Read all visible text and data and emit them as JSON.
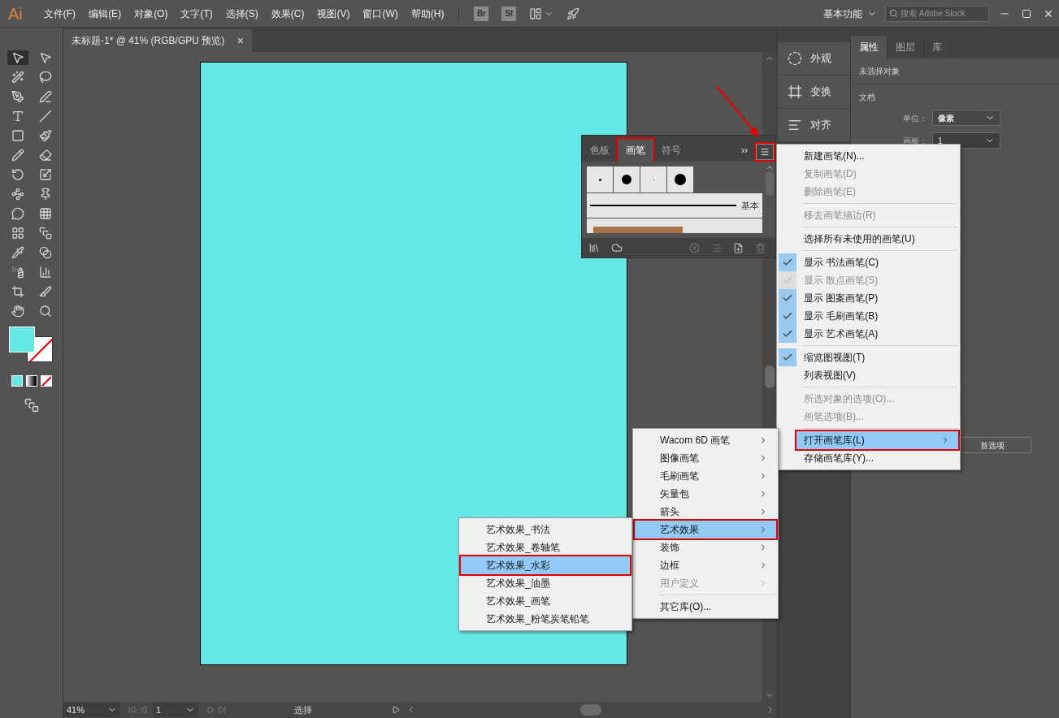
{
  "menubar": {
    "logo": "Ai",
    "menus": [
      "文件(F)",
      "编辑(E)",
      "对象(O)",
      "文字(T)",
      "选择(S)",
      "效果(C)",
      "视图(V)",
      "窗口(W)",
      "帮助(H)"
    ],
    "bridge": "Br",
    "stock": "St",
    "workspace": "基本功能",
    "search": {
      "placeholder": "搜索 Adobe Stock"
    }
  },
  "document_tab": {
    "title": "未标题-1* @ 41% (RGB/GPU 预览)",
    "close": "×"
  },
  "dock": [
    {
      "kind": "appearance",
      "label": "外观"
    },
    {
      "kind": "transform",
      "label": "变换"
    },
    {
      "kind": "align",
      "label": "对齐"
    }
  ],
  "properties": {
    "tabs": [
      {
        "label": "属性",
        "selected": true
      },
      {
        "label": "图层",
        "selected": false
      },
      {
        "label": "库",
        "selected": false
      }
    ],
    "status": "未选择对象",
    "section": "文档",
    "unit_label": "单位：",
    "unit_value": "像素",
    "artboard_label": "画板：",
    "artboard_value": "1",
    "preferences": "首选项"
  },
  "brushes_panel": {
    "tabs": [
      {
        "label": "色板",
        "selected": false,
        "annotated": false
      },
      {
        "label": "画笔",
        "selected": true,
        "annotated": true
      },
      {
        "label": "符号",
        "selected": false,
        "annotated": false
      }
    ],
    "more": "››",
    "basic_brush": "基本",
    "menu_annotated": true
  },
  "context_menu": [
    {
      "kind": "item",
      "label": "新建画笔(N)...",
      "checked": false,
      "disabled": false,
      "selected": false,
      "submenu": false,
      "annotated": false
    },
    {
      "kind": "item",
      "label": "复制画笔(D)",
      "checked": false,
      "disabled": true,
      "selected": false,
      "submenu": false,
      "annotated": false
    },
    {
      "kind": "item",
      "label": "删除画笔(E)",
      "checked": false,
      "disabled": true,
      "selected": false,
      "submenu": false,
      "annotated": false
    },
    {
      "kind": "separator"
    },
    {
      "kind": "item",
      "label": "移去画笔描边(R)",
      "checked": false,
      "disabled": true,
      "selected": false,
      "submenu": false,
      "annotated": false
    },
    {
      "kind": "separator"
    },
    {
      "kind": "item",
      "label": "选择所有未使用的画笔(U)",
      "checked": false,
      "disabled": false,
      "selected": false,
      "submenu": false,
      "annotated": false
    },
    {
      "kind": "separator"
    },
    {
      "kind": "item",
      "label": "显示 书法画笔(C)",
      "checked": true,
      "disabled": false,
      "selected": false,
      "submenu": false,
      "annotated": false
    },
    {
      "kind": "item",
      "label": "显示 散点画笔(S)",
      "checked": true,
      "disabled": true,
      "selected": false,
      "submenu": false,
      "annotated": false
    },
    {
      "kind": "item",
      "label": "显示 图案画笔(P)",
      "checked": true,
      "disabled": false,
      "selected": false,
      "submenu": false,
      "annotated": false
    },
    {
      "kind": "item",
      "label": "显示 毛刷画笔(B)",
      "checked": true,
      "disabled": false,
      "selected": false,
      "submenu": false,
      "annotated": false
    },
    {
      "kind": "item",
      "label": "显示 艺术画笔(A)",
      "checked": true,
      "disabled": false,
      "selected": false,
      "submenu": false,
      "annotated": false
    },
    {
      "kind": "separator"
    },
    {
      "kind": "item",
      "label": "缩览图视图(T)",
      "checked": true,
      "disabled": false,
      "selected": false,
      "submenu": false,
      "annotated": false
    },
    {
      "kind": "item",
      "label": "列表视图(V)",
      "checked": false,
      "disabled": false,
      "selected": false,
      "submenu": false,
      "annotated": false
    },
    {
      "kind": "separator"
    },
    {
      "kind": "item",
      "label": "所选对象的选项(O)...",
      "checked": false,
      "disabled": true,
      "selected": false,
      "submenu": false,
      "annotated": false
    },
    {
      "kind": "item",
      "label": "画笔选项(B)...",
      "checked": false,
      "disabled": true,
      "selected": false,
      "submenu": false,
      "annotated": false
    },
    {
      "kind": "separator"
    },
    {
      "kind": "item",
      "label": "打开画笔库(L)",
      "checked": false,
      "disabled": false,
      "selected": true,
      "submenu": true,
      "annotated": true
    },
    {
      "kind": "item",
      "label": "存储画笔库(Y)...",
      "checked": false,
      "disabled": false,
      "selected": false,
      "submenu": false,
      "annotated": false
    }
  ],
  "library_menu": [
    {
      "kind": "item",
      "label": "Wacom 6D 画笔",
      "disabled": false,
      "selected": false,
      "submenu": true,
      "annotated": false
    },
    {
      "kind": "item",
      "label": "图像画笔",
      "disabled": false,
      "selected": false,
      "submenu": true,
      "annotated": false
    },
    {
      "kind": "item",
      "label": "毛刷画笔",
      "disabled": false,
      "selected": false,
      "submenu": true,
      "annotated": false
    },
    {
      "kind": "item",
      "label": "矢量包",
      "disabled": false,
      "selected": false,
      "submenu": true,
      "annotated": false
    },
    {
      "kind": "item",
      "label": "箭头",
      "disabled": false,
      "selected": false,
      "submenu": true,
      "annotated": false
    },
    {
      "kind": "item",
      "label": "艺术效果",
      "disabled": false,
      "selected": true,
      "submenu": true,
      "annotated": true
    },
    {
      "kind": "item",
      "label": "装饰",
      "disabled": false,
      "selected": false,
      "submenu": true,
      "annotated": false
    },
    {
      "kind": "item",
      "label": "边框",
      "disabled": false,
      "selected": false,
      "submenu": true,
      "annotated": false
    },
    {
      "kind": "item",
      "label": "用户定义",
      "disabled": true,
      "selected": false,
      "submenu": true,
      "annotated": false
    },
    {
      "kind": "separator"
    },
    {
      "kind": "item",
      "label": "其它库(O)...",
      "disabled": false,
      "selected": false,
      "submenu": false,
      "annotated": false
    }
  ],
  "art_menu": [
    {
      "kind": "item",
      "label": "艺术效果_书法",
      "disabled": false,
      "selected": false,
      "submenu": false,
      "annotated": false
    },
    {
      "kind": "item",
      "label": "艺术效果_卷轴笔",
      "disabled": false,
      "selected": false,
      "submenu": false,
      "annotated": false
    },
    {
      "kind": "item",
      "label": "艺术效果_水彩",
      "disabled": false,
      "selected": true,
      "submenu": false,
      "annotated": true
    },
    {
      "kind": "item",
      "label": "艺术效果_油墨",
      "disabled": false,
      "selected": false,
      "submenu": false,
      "annotated": false
    },
    {
      "kind": "item",
      "label": "艺术效果_画笔",
      "disabled": false,
      "selected": false,
      "submenu": false,
      "annotated": false
    },
    {
      "kind": "item",
      "label": "艺术效果_粉笔炭笔铅笔",
      "disabled": false,
      "selected": false,
      "submenu": false,
      "annotated": false
    }
  ],
  "status_bar": {
    "zoom": "41%",
    "page": "1",
    "tool": "选择"
  }
}
